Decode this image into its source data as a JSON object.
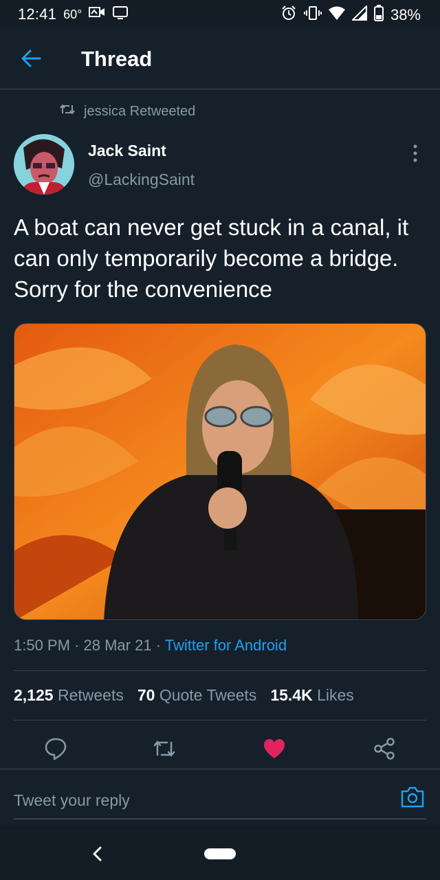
{
  "status_bar": {
    "time": "12:41",
    "temperature": "60°",
    "battery": "38%",
    "icons": [
      "video-call-icon",
      "cast-icon",
      "alarm-icon",
      "vibrate-icon",
      "wifi-icon",
      "signal-icon",
      "battery-icon"
    ]
  },
  "header": {
    "title": "Thread",
    "back_icon": "arrow-left-icon"
  },
  "retweet": {
    "text": "jessica Retweeted",
    "icon": "retweet-icon"
  },
  "author": {
    "name": "Jack Saint",
    "handle": "@LackingSaint"
  },
  "tweet": {
    "text": "A boat can never get stuck in a canal, it can only temporarily become a bridge. Sorry for the convenience",
    "time": "1:50 PM",
    "date": "28 Mar 21",
    "source": "Twitter for Android",
    "separator": "·"
  },
  "stats": {
    "retweets_count": "2,125",
    "retweets_label": "Retweets",
    "quotes_count": "70",
    "quotes_label": "Quote Tweets",
    "likes_count": "15.4K",
    "likes_label": "Likes"
  },
  "actions": {
    "reply_icon": "reply-icon",
    "retweet_icon": "retweet-icon",
    "like_icon": "heart-icon",
    "share_icon": "share-icon",
    "liked": true
  },
  "reply": {
    "placeholder": "Tweet your reply",
    "camera_icon": "camera-icon"
  },
  "colors": {
    "background": "#15202b",
    "accent": "#1da1f2",
    "secondary_text": "#8899a6",
    "like": "#e0245e",
    "divider": "#38444d"
  }
}
